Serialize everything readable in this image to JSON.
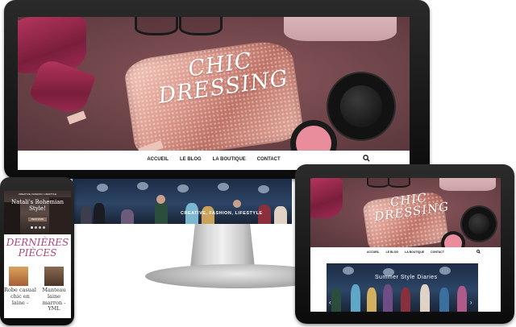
{
  "desktop": {
    "site_title_line1": "CHIC",
    "site_title_line2": "DRESSING",
    "nav": [
      "ACCUEIL",
      "LE BLOG",
      "LA BOUTIQUE",
      "CONTACT"
    ],
    "search_icon": "search-icon",
    "featured_caption": "CREATIVE, FASHION, LIFESTYLE"
  },
  "tablet": {
    "site_title_line1": "CHIC",
    "site_title_line2": "DRESSING",
    "nav": [
      "ACCUEIL",
      "LE BLOG",
      "LA BOUTIQUE",
      "CONTACT"
    ],
    "search_icon": "search-icon",
    "slide_title": "Summer Style Diaries",
    "prev_icon": "chevron-left-icon",
    "next_icon": "chevron-right-icon"
  },
  "phone": {
    "slide_category": "CREATIVE, FASHION, LIFESTYLE",
    "slide_title": "Natali's Bohemian Style!",
    "slide_button": "READ MORE",
    "section_title_line1": "DERNIÈRES",
    "section_title_line2": "PIÈCES",
    "products": [
      {
        "name": "Robe casual chic en laine -"
      },
      {
        "name": "Manteau laine marron - YML"
      }
    ]
  },
  "colors": {
    "hero_bg": "#6d4449",
    "accent_pink": "#b0457a",
    "device_black": "#111111"
  }
}
